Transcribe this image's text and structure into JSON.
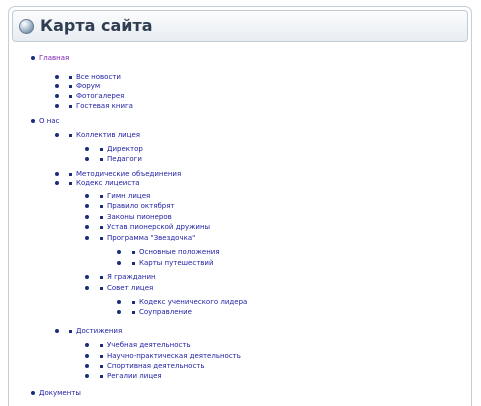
{
  "page": {
    "title": "Карта сайта"
  },
  "items": [
    {
      "label": "Главная",
      "level": 0,
      "accent": "#7a1fb5"
    },
    {
      "label": "Все новости",
      "level": 1
    },
    {
      "label": "Форум",
      "level": 1
    },
    {
      "label": "Фотогалерея",
      "level": 1
    },
    {
      "label": "Гостевая книга",
      "level": 1
    },
    {
      "label": "О нас",
      "level": 0
    },
    {
      "label": "Коллектив лицея",
      "level": 1
    },
    {
      "label": "Директор",
      "level": 2
    },
    {
      "label": "Педагоги",
      "level": 2
    },
    {
      "label": "Методические объединения",
      "level": 1
    },
    {
      "label": "Кодекс лицеиста",
      "level": 1
    },
    {
      "label": "Гимн лицея",
      "level": 2
    },
    {
      "label": "Правило октябрят",
      "level": 2
    },
    {
      "label": "Законы пионеров",
      "level": 2
    },
    {
      "label": "Устав пионерской дружины",
      "level": 2
    },
    {
      "label": "Программа \"Звездочка\"",
      "level": 2
    },
    {
      "label": "Основные положения",
      "level": 3
    },
    {
      "label": "Карты путешествий",
      "level": 3
    },
    {
      "label": "Я гражданин",
      "level": 2
    },
    {
      "label": "Совет лицея",
      "level": 2
    },
    {
      "label": "Кодекс ученического лидера",
      "level": 3
    },
    {
      "label": "Соуправление",
      "level": 3
    },
    {
      "label": "Достижения",
      "level": 1
    },
    {
      "label": "Учебная деятельность",
      "level": 2
    },
    {
      "label": "Научно-практическая деятельность",
      "level": 2
    },
    {
      "label": "Спортивная деятельность",
      "level": 2
    },
    {
      "label": "Регалии лицея",
      "level": 2
    },
    {
      "label": "Документы",
      "level": 0
    }
  ]
}
